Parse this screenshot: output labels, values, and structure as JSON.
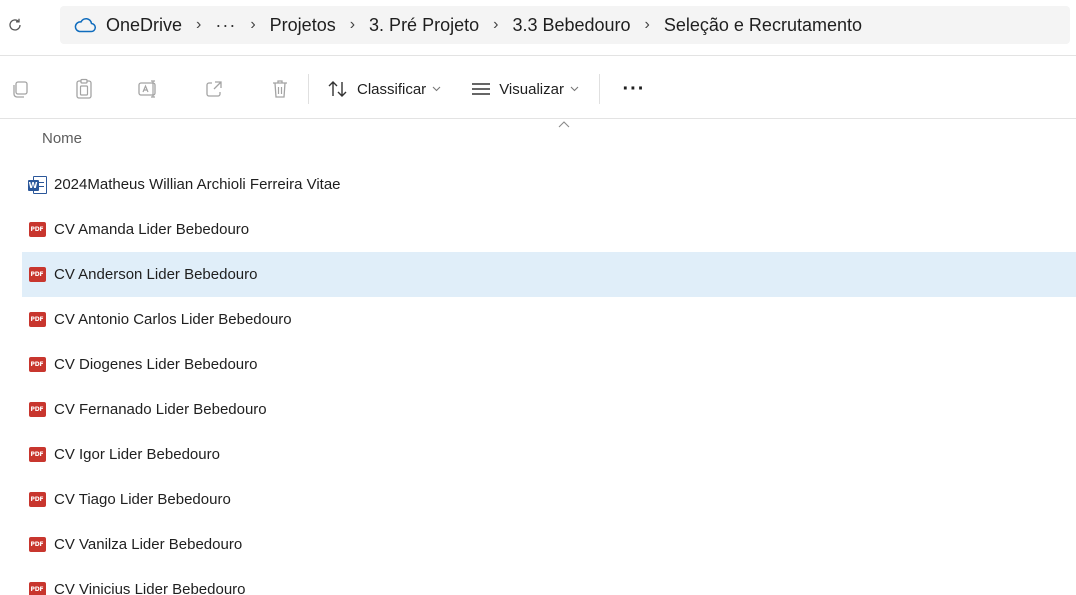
{
  "breadcrumb": {
    "root": "OneDrive",
    "ellipsis": "···",
    "separator": "›",
    "items": [
      "Projetos",
      "3. Pré Projeto",
      "3.3 Bebedouro",
      "Seleção e Recrutamento"
    ]
  },
  "toolbar": {
    "sort_label": "Classificar",
    "view_label": "Visualizar",
    "more_label": "···"
  },
  "columns": {
    "name": "Nome"
  },
  "files": [
    {
      "name": "2024Matheus Willian Archioli Ferreira Vitae",
      "type": "docx",
      "icon": "word-doc-icon",
      "selected": false
    },
    {
      "name": "CV Amanda Lider Bebedouro",
      "type": "pdf",
      "icon": "pdf-icon",
      "selected": false
    },
    {
      "name": "CV Anderson Lider Bebedouro",
      "type": "pdf",
      "icon": "pdf-icon",
      "selected": true
    },
    {
      "name": "CV Antonio Carlos Lider Bebedouro",
      "type": "pdf",
      "icon": "pdf-icon",
      "selected": false
    },
    {
      "name": "CV Diogenes Lider Bebedouro",
      "type": "pdf",
      "icon": "pdf-icon",
      "selected": false
    },
    {
      "name": "CV Fernanado Lider Bebedouro",
      "type": "pdf",
      "icon": "pdf-icon",
      "selected": false
    },
    {
      "name": "CV Igor Lider Bebedouro",
      "type": "pdf",
      "icon": "pdf-icon",
      "selected": false
    },
    {
      "name": "CV Tiago Lider Bebedouro",
      "type": "pdf",
      "icon": "pdf-icon",
      "selected": false
    },
    {
      "name": "CV Vanilza Lider Bebedouro",
      "type": "pdf",
      "icon": "pdf-icon",
      "selected": false
    },
    {
      "name": "CV Vinicius Lider Bebedouro",
      "type": "pdf",
      "icon": "pdf-icon",
      "selected": false
    }
  ],
  "colors": {
    "selection": "#e0eef9",
    "pdf": "#c8362e",
    "word": "#2b579a"
  }
}
